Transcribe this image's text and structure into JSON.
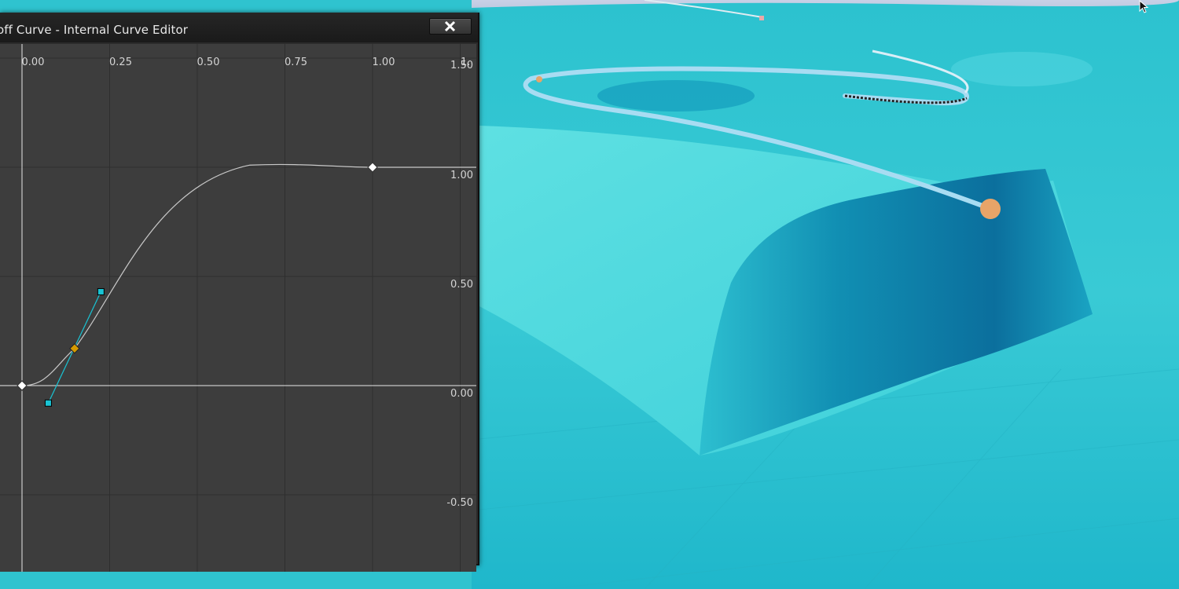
{
  "window": {
    "title": "off Curve - Internal Curve Editor",
    "close_icon": "close-icon"
  },
  "graph": {
    "x_ticks": [
      "0.00",
      "0.25",
      "0.50",
      "0.75",
      "1.00"
    ],
    "y_ticks": [
      "1.50",
      "1.00",
      "0.50",
      "0.00",
      "-0.50"
    ],
    "x_extra_label": "1.",
    "keys": [
      {
        "time": 0.0,
        "value": 0.0
      },
      {
        "time": 1.0,
        "value": 1.0
      }
    ],
    "selected_key": {
      "time": 0.15,
      "value": 0.17
    },
    "tangent_handles": [
      {
        "time": 0.075,
        "value": -0.08
      },
      {
        "time": 0.225,
        "value": 0.43
      }
    ],
    "colors": {
      "panel_bg": "#3d3d3d",
      "grid": "#2e2e2e",
      "curve": "#c8c8c8",
      "key": "#ffffff",
      "selected_key": "#d59a00",
      "tangent": "#19c4d4"
    }
  },
  "viewport": {
    "landscape_color": "#2fc3cf",
    "spline_color": "#a8dcf2",
    "spline_endpoint_color": "#e8a468"
  },
  "cursor_icon": "mouse-cursor-icon"
}
